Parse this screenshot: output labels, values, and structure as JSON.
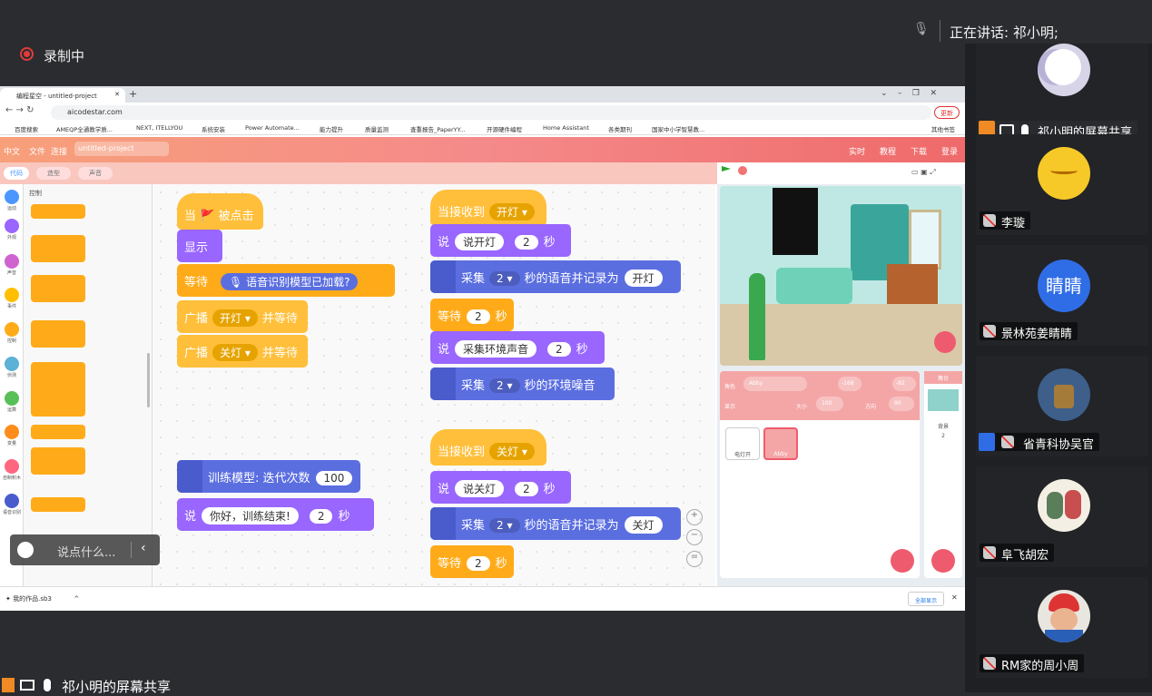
{
  "meeting": {
    "recording": "录制中",
    "speaking": "正在讲话: 祁小明;",
    "share_label": "祁小明的屏幕共享",
    "chat_placeholder": "说点什么..."
  },
  "participants": [
    {
      "name": "祁小明的屏幕共享",
      "avatar": "moon-avatar"
    },
    {
      "name": "李璇",
      "avatar": "cartoon-avatar"
    },
    {
      "name": "景林苑姜睛睛",
      "avatar": "text-avatar",
      "avatar_text": "睛睛",
      "color": "#2f6de6"
    },
    {
      "name": "省青科协吴官",
      "avatar": "robot-avatar"
    },
    {
      "name": "阜飞胡宏",
      "avatar": "kids-avatar"
    },
    {
      "name": "RM家的周小周",
      "avatar": "child-avatar"
    }
  ],
  "browser": {
    "tab_title": "编程星空 - untitled-project",
    "url": "aicodestar.com",
    "update": "更新",
    "bookmarks": [
      "百度搜索",
      "AMEQP全通教学质...",
      "NEXT, ITELLYOU",
      "系统安装",
      "Power Automate...",
      "能力提升",
      "质量监测",
      "查重报告_PaperYY...",
      "开源硬件编程",
      "Home Assistant",
      "各类期刊",
      "国家中小学智慧教...",
      "其他书签"
    ],
    "download_file": "我的作品.sb3",
    "download_all": "全部显示"
  },
  "scratch": {
    "menu": [
      "中文",
      "文件",
      "连接"
    ],
    "project": "untitled-project",
    "menu_right": [
      "实时",
      "教程",
      "下载",
      "登录"
    ],
    "tabs": [
      "代码",
      "造型",
      "声音"
    ],
    "categories": [
      "运动",
      "外观",
      "声音",
      "事件",
      "控制",
      "侦测",
      "运算",
      "变量",
      "自制积木",
      "语音识别"
    ],
    "palette_title": "控制",
    "script1": {
      "hat": "当 🚩 被点击",
      "show": "显示",
      "wait_label": "等待",
      "wait_cond": "语音识别模型已加载?",
      "bc1_label": "广播",
      "bc1_msg": "开灯",
      "bc1_tail": "并等待",
      "bc2_label": "广播",
      "bc2_msg": "关灯",
      "bc2_tail": "并等待",
      "train": "训练模型: 迭代次数",
      "train_n": "100",
      "say": "说",
      "say_text": "你好，训练结束!",
      "say_n": "2",
      "say_unit": "秒"
    },
    "script2": {
      "hat": "当接收到",
      "hat_msg": "开灯",
      "say": "说",
      "say_text": "说开灯",
      "say_n": "2",
      "unit": "秒",
      "rec_label": "采集",
      "rec_n": "2",
      "rec_mid": "秒的语音并记录为",
      "rec_tag": "开灯",
      "wait": "等待",
      "wait_n": "2",
      "say2_text": "采集环境声音",
      "say2_n": "2",
      "noise_label": "采集",
      "noise_n": "2",
      "noise_tail": "秒的环境噪音"
    },
    "script3": {
      "hat": "当接收到",
      "hat_msg": "关灯",
      "say": "说",
      "say_text": "说关灯",
      "say_n": "2",
      "unit": "秒",
      "rec_label": "采集",
      "rec_n": "2",
      "rec_mid": "秒的语音并记录为",
      "rec_tag": "关灯",
      "wait": "等待",
      "wait_n": "2"
    },
    "sprite": {
      "label": "角色",
      "name": "Abby",
      "x": "-168",
      "y": "-82",
      "show": "显示",
      "size_label": "大小",
      "size": "100",
      "dir_label": "方向",
      "dir": "90"
    },
    "sprites": [
      "电灯开",
      "Abby"
    ],
    "stage": {
      "label": "舞台",
      "bg_label": "背景",
      "bg_count": "2"
    }
  }
}
